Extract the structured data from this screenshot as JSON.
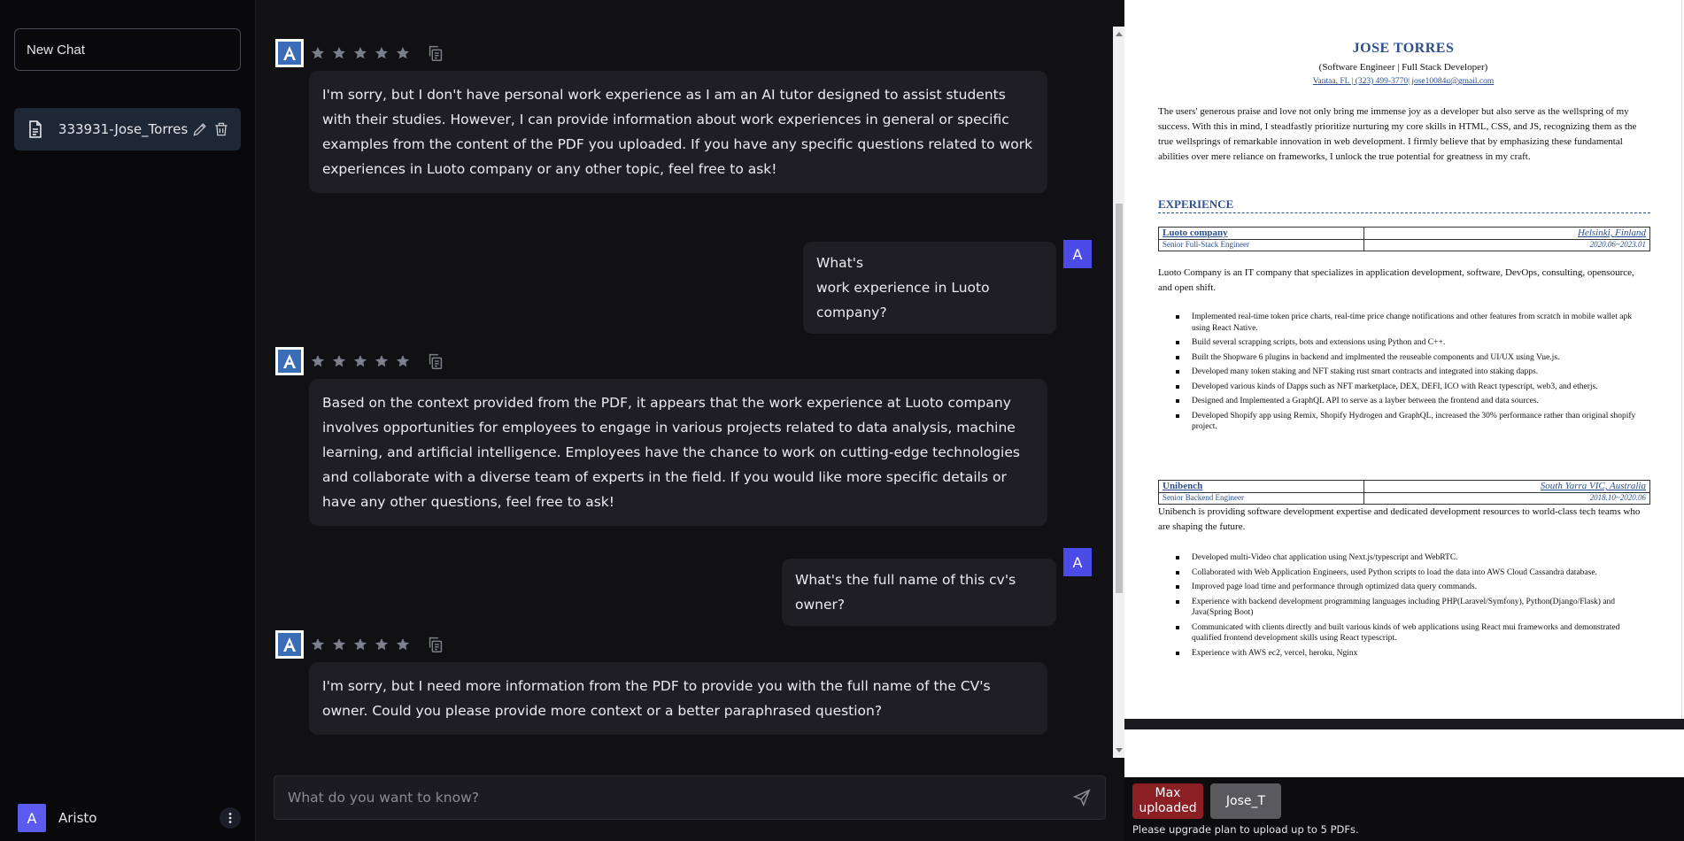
{
  "sidebar": {
    "new_chat_label": "New Chat",
    "chats": [
      {
        "label": "333931-Jose_Torres"
      }
    ],
    "user": {
      "initial": "A",
      "name": "Aristo"
    }
  },
  "chat": {
    "bot_initial": "A",
    "user_initial": "A",
    "messages": [
      {
        "role": "bot",
        "text": "I'm sorry, but I don't have personal work experience as I am an AI tutor designed to assist students with their studies. However, I can provide information about work experiences in general or specific examples from the content of the PDF you uploaded. If you have any specific questions related to work experiences in Luoto company or any other topic, feel free to ask!"
      },
      {
        "role": "user",
        "line1": "What's",
        "line2": "work experience in Luoto company?"
      },
      {
        "role": "bot",
        "text": "Based on the context provided from the PDF, it appears that the work experience at Luoto company involves opportunities for employees to engage in various projects related to data analysis, machine learning, and artificial intelligence. Employees have the chance to work on cutting-edge technologies and collaborate with a diverse team of experts in the field. If you would like more specific details or have any other questions, feel free to ask!"
      },
      {
        "role": "user",
        "text": "What's the full name of this cv's owner?"
      },
      {
        "role": "bot",
        "text": "I'm sorry, but I need more information from the PDF to provide you with the full name of the CV's owner. Could you please provide more context or a better paraphrased question?"
      }
    ],
    "input_placeholder": "What do you want to know?"
  },
  "pdf": {
    "name": "JOSE TORRES",
    "role": "(Software Engineer | Full Stack Developer)",
    "contact": "Vantaa, FL | (323) 499-3770| jose10084u@gmail.com",
    "summary": "The users' generous praise and love not only bring me immense joy as a developer but also serve as the wellspring of my success. With this in mind, I steadfastly prioritize nurturing my core skills in HTML, CSS, and JS, recognizing them as the true wellsprings of remarkable innovation in web development. I firmly believe that by emphasizing these fundamental abilities over mere reliance on frameworks, I unlock the true potential for greatness in my craft.",
    "section_experience": "EXPERIENCE",
    "jobs": [
      {
        "company": "Luoto company",
        "location": "Helsinki, Finland",
        "title": "Senior Full-Stack Engineer",
        "dates": "2020.06~2023.01",
        "desc": "Luoto Company is an IT company that specializes in application development, software, DevOps, consulting, opensource, and open shift.",
        "bullets": [
          "Implemented real-time token price charts, real-time price change notifications and other features from scratch in mobile wallet apk using React Native.",
          "Build several scrapping scripts, bots and extensions using Python and C++.",
          "Built the Shopware 6 plugins in backend and implmented the reuseable components and UI/UX using Vue.js.",
          "Developed many token staking and NFT staking rust smart contracts and integrated into staking dapps.",
          "Developed various kinds of Dapps such as NFT marketplace, DEX, DEFI, ICO with React typescript, web3, and etherjs.",
          "Designed and Implemented a GraphQL API to serve as a layber between the frontend and data sources.",
          "Developed Shopify app using Remix, Shopify Hydrogen and GraphQL, increased the 30% performance rather than original shopify project."
        ]
      },
      {
        "company": "Unibench",
        "location": "South Yarra VIC, Australia",
        "title": "Senior Backend Engineer",
        "dates": "2018.10~2020.06",
        "desc": "Unibench is providing software development expertise and dedicated development resources to world-class tech teams who are shaping the future.",
        "bullets": [
          "Developed multi-Video chat application using Next.js/typescript and WebRTC.",
          "Collaborated with Web Application Engineers, used Python scripts to load the data into AWS Cloud Cassandra database.",
          "Improved page load time and performance through optimized data query commands.",
          "Experience with backend development programming languages including PHP(Laravel/Symfony), Python(Django/Flask) and Java(Spring Boot)",
          "Communicated with clients directly and built various kinds of web applications using React mui frameworks and demonstrated qualified frontend development skills using React typescript.",
          "Experience with AWS ec2, vercel, heroku, Nginx"
        ]
      }
    ]
  },
  "footer": {
    "max_label": "Max uploaded",
    "pdf_tab_label": "Jose_T",
    "upgrade_note": "Please upgrade plan to upload up to 5 PDFs."
  },
  "colors": {
    "accent": "#4b4be8",
    "danger": "#8b1f24",
    "cv_blue": "#2b4f8f"
  }
}
